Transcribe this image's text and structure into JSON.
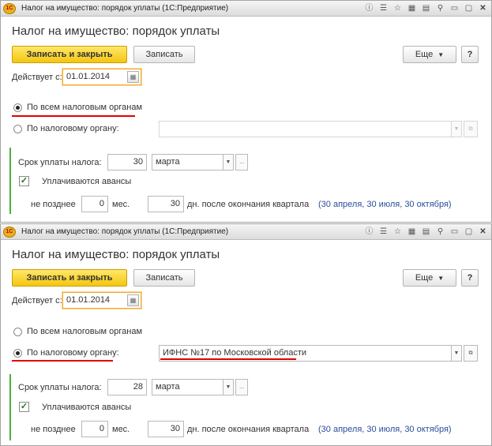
{
  "colors": {
    "accent_yellow": "#f3c610",
    "group_bar": "#4caf3c",
    "highlight_underline": "#e00000",
    "link": "#2a4d9b"
  },
  "window1": {
    "app_logo": "1С",
    "title": "Налог на имущество: порядок уплаты (1С:Предприятие)",
    "form_title": "Налог на имущество: порядок уплаты",
    "buttons": {
      "save_close": "Записать и закрыть",
      "save": "Записать",
      "more": "Еще",
      "help": "?"
    },
    "valid_from_label": "Действует с:",
    "valid_from_value": "01.01.2014",
    "radio_all": {
      "label": "По всем налоговым органам",
      "selected": true
    },
    "radio_one": {
      "label": "По налоговому органу:",
      "selected": false
    },
    "tax_authority_value": "",
    "due_label": "Срок уплаты налога:",
    "due_day": "30",
    "due_month": "марта",
    "advances_label": "Уплачиваются авансы",
    "advances_checked": true,
    "not_later_label": "не позднее",
    "months_value": "0",
    "months_label": "мес.",
    "days_value": "30",
    "days_label": "дн. после окончания квартала",
    "schedule_link": "(30 апреля, 30 июля, 30 октября)"
  },
  "window2": {
    "app_logo": "1С",
    "title": "Налог на имущество: порядок уплаты (1С:Предприятие)",
    "form_title": "Налог на имущество: порядок уплаты",
    "buttons": {
      "save_close": "Записать и закрыть",
      "save": "Записать",
      "more": "Еще",
      "help": "?"
    },
    "valid_from_label": "Действует с:",
    "valid_from_value": "01.01.2014",
    "radio_all": {
      "label": "По всем налоговым органам",
      "selected": false
    },
    "radio_one": {
      "label": "По налоговому органу:",
      "selected": true
    },
    "tax_authority_value": "ИФНС №17 по Московской области",
    "due_label": "Срок уплаты налога:",
    "due_day": "28",
    "due_month": "марта",
    "advances_label": "Уплачиваются авансы",
    "advances_checked": true,
    "not_later_label": "не позднее",
    "months_value": "0",
    "months_label": "мес.",
    "days_value": "30",
    "days_label": "дн. после окончания квартала",
    "schedule_link": "(30 апреля, 30 июля, 30 октября)"
  },
  "icons": {
    "titlebar": [
      "info-icon",
      "list-icon",
      "star-icon",
      "calc-icon",
      "calendar-icon",
      "zoom-icon",
      "minimize-icon",
      "maximize-icon",
      "close-icon"
    ],
    "titlebar_glyphs": [
      "ⓘ",
      "☰",
      "☆",
      "▦",
      "▤",
      "⚲",
      "▭",
      "▢",
      "✕"
    ],
    "calendar": "▦",
    "dropdown": "▼",
    "open": "⧉",
    "ellipsis": "..."
  }
}
